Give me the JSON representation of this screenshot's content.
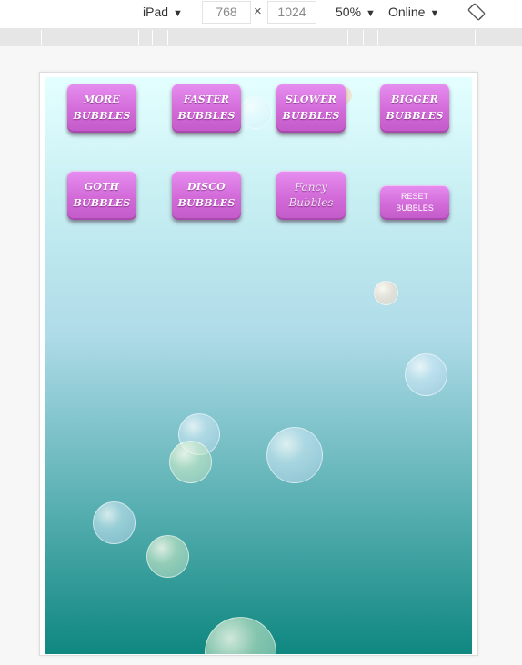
{
  "toolbar": {
    "device": "iPad",
    "width": "768",
    "times": "×",
    "height": "1024",
    "zoom": "50%",
    "throttle": "Online",
    "caret": "▼"
  },
  "buttons": {
    "more": [
      "MORE",
      "BUBBLES"
    ],
    "faster": [
      "FASTER",
      "BUBBLES"
    ],
    "slower": [
      "SLOWER",
      "BUBBLES"
    ],
    "bigger": [
      "BIGGER",
      "BUBBLES"
    ],
    "goth": [
      "GOTH",
      "BUBBLES"
    ],
    "disco": [
      "DISCO",
      "BUBBLES"
    ],
    "fancy": [
      "Fancy",
      "Bubbles"
    ],
    "reset": [
      "RESET",
      "BUBBLES"
    ]
  },
  "colors": {
    "button": "#d26ad8",
    "screen_top": "#e4ffff",
    "screen_bottom": "#0f8780"
  }
}
